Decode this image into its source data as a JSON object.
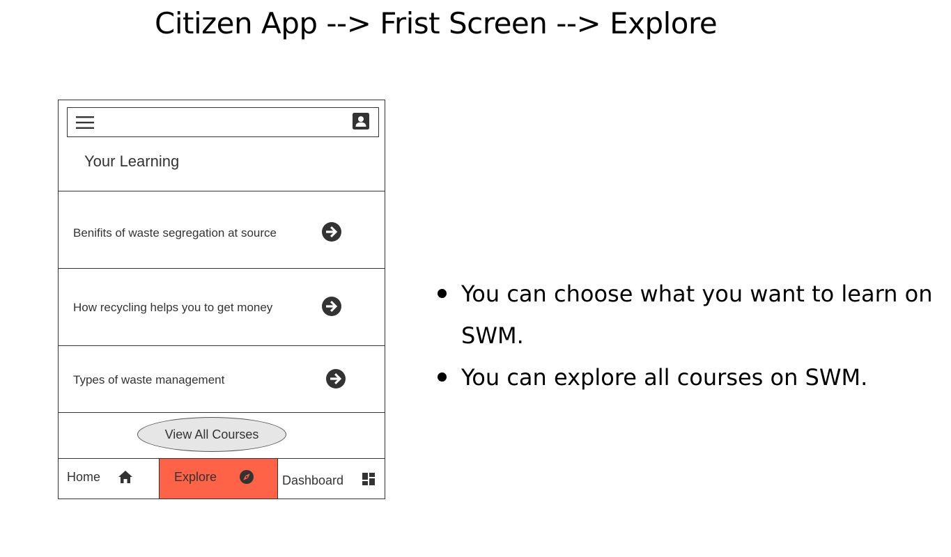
{
  "page": {
    "title": "Citizen App --> Frist Screen --> Explore"
  },
  "app": {
    "section_title": "Your Learning",
    "courses": [
      {
        "label": "Benifits of waste segregation at source"
      },
      {
        "label": "How recycling helps you to get money"
      },
      {
        "label": "Types of waste management"
      }
    ],
    "view_all_label": "View All Courses",
    "nav": [
      {
        "label": "Home",
        "icon": "home-icon",
        "active": false
      },
      {
        "label": "Explore",
        "icon": "compass-icon",
        "active": true
      },
      {
        "label": "Dashboard",
        "icon": "dashboard-icon",
        "active": false
      }
    ],
    "icons": {
      "menu": "menu-icon",
      "profile": "profile-icon",
      "course_arrow": "arrow-right-circle-icon"
    }
  },
  "notes": [
    "You can choose what you want to learn on SWM.",
    "You can explore all courses on SWM."
  ],
  "colors": {
    "active_nav_bg": "#ff6347",
    "icon_dark": "#333333",
    "button_bg": "#e6e6e6"
  }
}
